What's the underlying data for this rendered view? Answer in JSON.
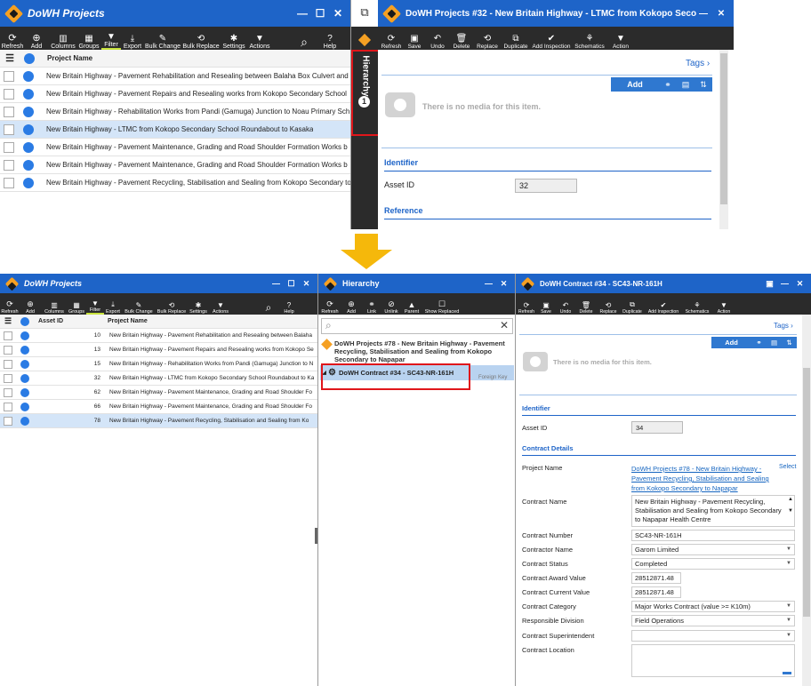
{
  "top": {
    "left_window": {
      "title": "DoWH Projects",
      "toolbar": [
        "Refresh",
        "Add",
        "Columns",
        "Groups",
        "Filter",
        "Export",
        "Bulk Change",
        "Bulk Replace",
        "Settings",
        "Actions"
      ],
      "help": "Help",
      "column": "Project Name",
      "rows": [
        "New Britain Highway - Pavement Rehabilitation and Resealing between Balaha Box Culvert and",
        "New Britain Highway - Pavement Repairs and Resealing works from Kokopo Secondary School",
        "New Britain Highway - Rehabilitation Works from Pandi (Gamuga) Junction to Noau Primary Sch",
        "New Britain Highway - LTMC from Kokopo Secondary School Roundabout to Kasaka",
        "New Britain Highway - Pavement Maintenance, Grading and Road Shoulder Formation Works b",
        "New Britain Highway - Pavement Maintenance, Grading and Road Shoulder Formation Works b",
        "New Britain Highway - Pavement Recycling, Stabilisation and Sealing from Kokopo Secondary to"
      ],
      "selected_index": 3
    },
    "hierarchy_tab": {
      "label": "Hierarchy",
      "count": "1"
    },
    "right_window": {
      "title": "DoWH Projects #32 - New Britain Highway - LTMC from Kokopo Secon...",
      "toolbar": [
        "Refresh",
        "Save",
        "Undo",
        "Delete",
        "Replace",
        "Duplicate",
        "Add Inspection",
        "Schematics",
        "Action"
      ],
      "tags": "Tags",
      "add": "Add",
      "no_media": "There is no media for this item.",
      "identifier": "Identifier",
      "asset_id_label": "Asset ID",
      "asset_id": "32",
      "reference": "Reference"
    }
  },
  "bottom": {
    "left_window": {
      "title": "DoWH Projects",
      "toolbar": [
        "Refresh",
        "Add",
        "Columns",
        "Groups",
        "Filter",
        "Export",
        "Bulk Change",
        "Bulk Replace",
        "Settings",
        "Actions"
      ],
      "help": "Help",
      "col_id": "Asset ID",
      "col_name": "Project Name",
      "rows": [
        {
          "id": "10",
          "name": "New Britain Highway - Pavement Rehabilitation and Resealing between Balaha"
        },
        {
          "id": "13",
          "name": "New Britain Highway - Pavement Repairs and Resealing works from Kokopo Se"
        },
        {
          "id": "15",
          "name": "New Britain Highway - Rehabilitation Works from Pandi (Gamuga) Junction to N"
        },
        {
          "id": "32",
          "name": "New Britain Highway - LTMC from Kokopo Secondary School Roundabout to Ka"
        },
        {
          "id": "62",
          "name": "New Britain Highway - Pavement Maintenance, Grading and Road Shoulder Fo"
        },
        {
          "id": "66",
          "name": "New Britain Highway - Pavement Maintenance, Grading and Road Shoulder Fo"
        },
        {
          "id": "78",
          "name": "New Britain Highway - Pavement Recycling, Stabilisation and Sealing from Ko"
        }
      ],
      "selected_index": 6
    },
    "hierarchy": {
      "title": "Hierarchy",
      "toolbar": [
        "Refresh",
        "Add",
        "Link",
        "Unlink",
        "Parent",
        "Show Replaced"
      ],
      "parent": "DoWH Projects #78 - New Britain Highway - Pavement Recycling, Stabilisation and Sealing from Kokopo Secondary to Napapar",
      "child": "DoWH Contract #34 - SC43-NR-161H",
      "child_note": "Foreign Key"
    },
    "contract": {
      "title": "DoWH Contract #34 - SC43-NR-161H",
      "toolbar": [
        "Refresh",
        "Save",
        "Undo",
        "Delete",
        "Replace",
        "Duplicate",
        "Add Inspection",
        "Schematics",
        "Action"
      ],
      "tags": "Tags",
      "add": "Add",
      "no_media": "There is no media for this item.",
      "identifier": "Identifier",
      "asset_id_label": "Asset ID",
      "asset_id": "34",
      "details": "Contract Details",
      "project_name_label": "Project Name",
      "project_name": "DoWH Projects #78 - New Britain Highway - Pavement Recycling, Stabilisation and Sealing from Kokopo Secondary to Napapar",
      "select": "Select",
      "contract_name_label": "Contract Name",
      "contract_name": "New Britain Highway - Pavement Recycling, Stabilisation and Sealing from Kokopo Secondary to Napapar Health Centre",
      "fields": [
        {
          "label": "Contract Number",
          "value": "SC43-NR-161H"
        },
        {
          "label": "Contractor Name",
          "value": "Garom Limited"
        },
        {
          "label": "Contract Status",
          "value": "Completed"
        },
        {
          "label": "Contract Award Value",
          "value": "28512871.48"
        },
        {
          "label": "Contract Current Value",
          "value": "28512871.48"
        },
        {
          "label": "Contract Category",
          "value": "Major Works Contract (value >= K10m)"
        },
        {
          "label": "Responsible Division",
          "value": "Field Operations"
        },
        {
          "label": "Contract Superintendent",
          "value": ""
        },
        {
          "label": "Contract Location",
          "value": ""
        }
      ]
    }
  },
  "colors": {
    "title_bar": "#1e64c8",
    "toolbar": "#2b2b2b",
    "highlight": "#e0161b",
    "arrow": "#f5b80b"
  }
}
